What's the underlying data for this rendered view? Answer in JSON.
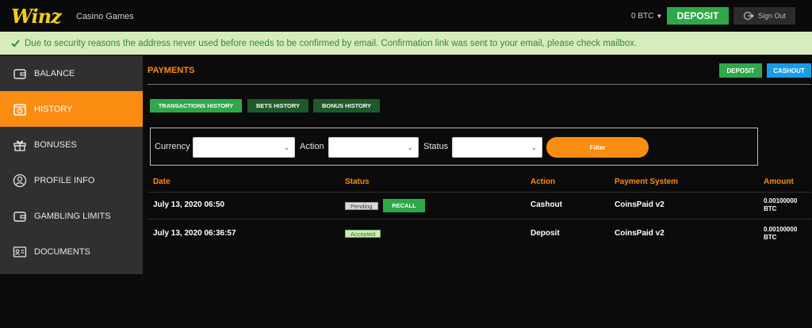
{
  "header": {
    "logo": "Winz",
    "nav_casino": "Casino Games",
    "balance": "0 BTC",
    "deposit_label": "DEPOSIT",
    "signout_label": "Sign Out"
  },
  "notice": {
    "text": "Due to security reasons the address never used before needs to be confirmed by email. Confirmation link was sent to your email, please check mailbox.",
    "icon": "check-icon"
  },
  "sidebar": {
    "items": [
      {
        "label": "BALANCE",
        "icon": "wallet-icon"
      },
      {
        "label": "HISTORY",
        "icon": "history-icon",
        "active": true
      },
      {
        "label": "BONUSES",
        "icon": "gift-icon"
      },
      {
        "label": "PROFILE INFO",
        "icon": "user-icon"
      },
      {
        "label": "GAMBLING LIMITS",
        "icon": "wallet-icon"
      },
      {
        "label": "DOCUMENTS",
        "icon": "id-card-icon"
      }
    ]
  },
  "main": {
    "title": "PAYMENTS",
    "deposit_label": "DEPOSIT",
    "cashout_label": "CASHOUT",
    "tabs": [
      {
        "label": "TRANSACTIONS HISTORY",
        "active": true
      },
      {
        "label": "BETS HISTORY"
      },
      {
        "label": "BONUS HISTORY"
      }
    ],
    "filter": {
      "currency_label": "Currency",
      "currency_value": "",
      "action_label": "Action",
      "action_value": "",
      "status_label": "Status",
      "status_value": "",
      "button_label": "Filter"
    },
    "table": {
      "columns": [
        "Date",
        "Status",
        "Action",
        "Payment System",
        "Amount"
      ],
      "rows": [
        {
          "date": "July 13, 2020 06:50",
          "status": "Pending",
          "recall": "RECALL",
          "action": "Cashout",
          "system": "CoinsPaid v2",
          "amount": "0.00100000",
          "currency": "BTC"
        },
        {
          "date": "July 13, 2020 06:36:57",
          "status": "Accepted",
          "action": "Deposit",
          "system": "CoinsPaid v2",
          "amount": "0.00100000",
          "currency": "BTC"
        }
      ]
    }
  },
  "colors": {
    "accent_orange": "#fb8c12",
    "green": "#2fa84a",
    "blue": "#1a9be6",
    "logo_yellow": "#f3cf1a",
    "notice_bg": "#d6ecbc"
  }
}
